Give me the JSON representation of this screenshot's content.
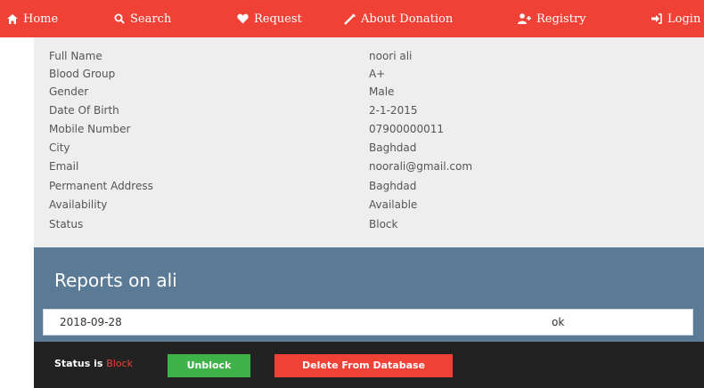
{
  "nav": {
    "items": [
      {
        "label": "Home",
        "icon": "home-icon"
      },
      {
        "label": "Search",
        "icon": "search-icon"
      },
      {
        "label": "Request",
        "icon": "heart-icon"
      },
      {
        "label": "About Donation",
        "icon": "syringe-icon"
      },
      {
        "label": "Registry",
        "icon": "user-plus-icon"
      },
      {
        "label": "Login",
        "icon": "sign-in-icon"
      }
    ]
  },
  "details": {
    "rows": [
      {
        "label": "Full Name",
        "value": "noori ali"
      },
      {
        "label": "Blood Group",
        "value": "A+"
      },
      {
        "label": "Gender",
        "value": "Male"
      },
      {
        "label": "Date Of Birth",
        "value": "2-1-2015"
      },
      {
        "label": "Mobile Number",
        "value": "07900000011"
      },
      {
        "label": "City",
        "value": "Baghdad"
      },
      {
        "label": "Email",
        "value": "noorali@gmail.com"
      },
      {
        "label": "Permanent Address",
        "value": "Baghdad"
      },
      {
        "label": "Availability",
        "value": "Available"
      },
      {
        "label": "Status",
        "value": "Block"
      }
    ]
  },
  "reports": {
    "title": "Reports on ali",
    "rows": [
      {
        "date": "2018-09-28",
        "result": "ok"
      }
    ]
  },
  "statusbar": {
    "label": "Status is",
    "value": "Block",
    "unblock_label": "Unblock",
    "delete_label": "Delete From Database"
  },
  "colors": {
    "nav_bg": "#ef4136",
    "panel_bg": "#eeeeee",
    "reports_bg": "#5a7a96",
    "statusbar_bg": "#222222",
    "unblock_bg": "#3fb24a",
    "delete_bg": "#ef4136"
  }
}
